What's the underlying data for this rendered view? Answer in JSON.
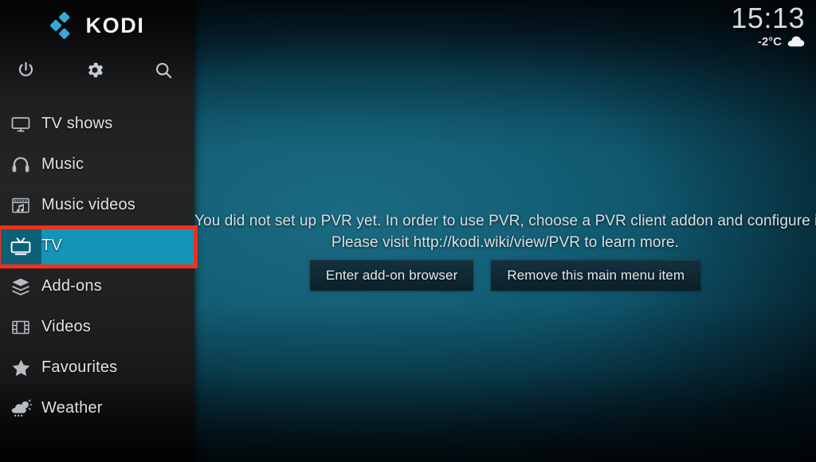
{
  "app": {
    "name": "KODI",
    "logo_icon": "kodi-diamond-logo",
    "logo_color": "#3aa9d8"
  },
  "toolbar": {
    "power_icon": "power-icon",
    "settings_icon": "gear-icon",
    "search_icon": "search-icon"
  },
  "status": {
    "time": "15:13",
    "temperature": "-2°C",
    "weather_icon": "cloud-icon"
  },
  "sidebar": {
    "items": [
      {
        "label": "TV shows",
        "icon": "tv-monitor-icon",
        "selected": false
      },
      {
        "label": "Music",
        "icon": "headphones-icon",
        "selected": false
      },
      {
        "label": "Music videos",
        "icon": "music-video-icon",
        "selected": false
      },
      {
        "label": "TV",
        "icon": "television-icon",
        "selected": true
      },
      {
        "label": "Add-ons",
        "icon": "package-box-icon",
        "selected": false
      },
      {
        "label": "Videos",
        "icon": "film-strip-icon",
        "selected": false
      },
      {
        "label": "Favourites",
        "icon": "star-icon",
        "selected": false
      },
      {
        "label": "Weather",
        "icon": "cloud-sun-rain-icon",
        "selected": false
      }
    ],
    "selected_item": "TV",
    "highlight_color": "#1395b8",
    "highlight_icon_color": "#0d6177"
  },
  "annotation": {
    "color": "#fc2d1a",
    "target": "TV"
  },
  "main": {
    "message_line1": "You did not set up PVR yet. In order to use PVR, choose a PVR client addon and configure it.",
    "message_line2": "Please visit http://kodi.wiki/view/PVR to learn more.",
    "buttons": [
      {
        "label": "Enter add-on browser"
      },
      {
        "label": "Remove this main menu item"
      }
    ]
  }
}
